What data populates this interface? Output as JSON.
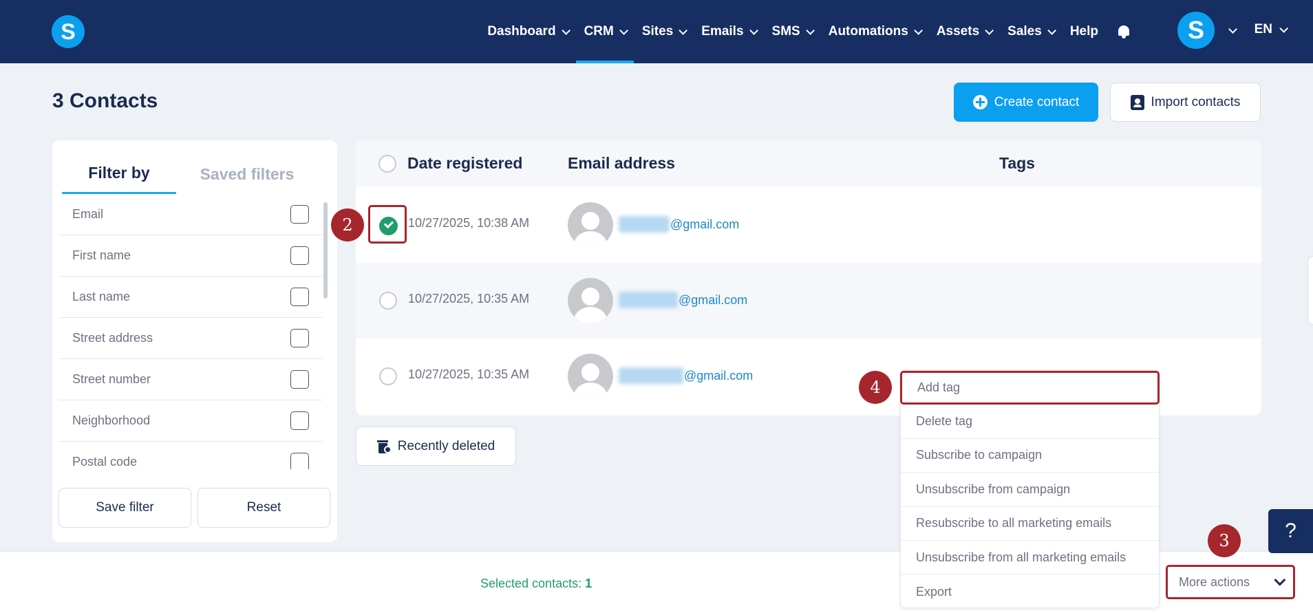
{
  "nav": {
    "logo": "S",
    "items": [
      {
        "label": "Dashboard",
        "has_menu": true,
        "active": false
      },
      {
        "label": "CRM",
        "has_menu": true,
        "active": true
      },
      {
        "label": "Sites",
        "has_menu": true,
        "active": false
      },
      {
        "label": "Emails",
        "has_menu": true,
        "active": false
      },
      {
        "label": "SMS",
        "has_menu": true,
        "active": false
      },
      {
        "label": "Automations",
        "has_menu": true,
        "active": false
      },
      {
        "label": "Assets",
        "has_menu": true,
        "active": false
      },
      {
        "label": "Sales",
        "has_menu": true,
        "active": false
      },
      {
        "label": "Help",
        "has_menu": false,
        "active": false
      }
    ],
    "user_initial": "S",
    "language": "EN"
  },
  "page": {
    "title": "3 Contacts",
    "create_label": "Create contact",
    "import_label": "Import contacts"
  },
  "filters": {
    "tabs": {
      "active": "Filter by",
      "inactive": "Saved filters"
    },
    "fields": [
      "Email",
      "First name",
      "Last name",
      "Street address",
      "Street number",
      "Neighborhood",
      "Postal code"
    ],
    "save_label": "Save filter",
    "reset_label": "Reset"
  },
  "table": {
    "headers": {
      "date": "Date registered",
      "email": "Email address",
      "tags": "Tags"
    },
    "rows": [
      {
        "date": "10/27/2025, 10:38 AM",
        "email_domain": "@gmail.com",
        "selected": true
      },
      {
        "date": "10/27/2025, 10:35 AM",
        "email_domain": "@gmail.com",
        "selected": false
      },
      {
        "date": "10/27/2025, 10:35 AM",
        "email_domain": "@gmail.com",
        "selected": false
      }
    ]
  },
  "recently_deleted_label": "Recently deleted",
  "bottom": {
    "selected_label": "Selected contacts: ",
    "selected_count": "1",
    "more_actions_label": "More actions"
  },
  "dropdown": {
    "items": [
      "Add tag",
      "Delete tag",
      "Subscribe to campaign",
      "Unsubscribe from campaign",
      "Resubscribe to all marketing emails",
      "Unsubscribe from all marketing emails",
      "Export"
    ]
  },
  "steps": {
    "s2": "2",
    "s3": "3",
    "s4": "4"
  },
  "help_label": "?",
  "colors": {
    "nav_bg": "#172e62",
    "accent": "#0b9ff0",
    "success": "#1f9d6b",
    "annotation": "#a6262d"
  }
}
